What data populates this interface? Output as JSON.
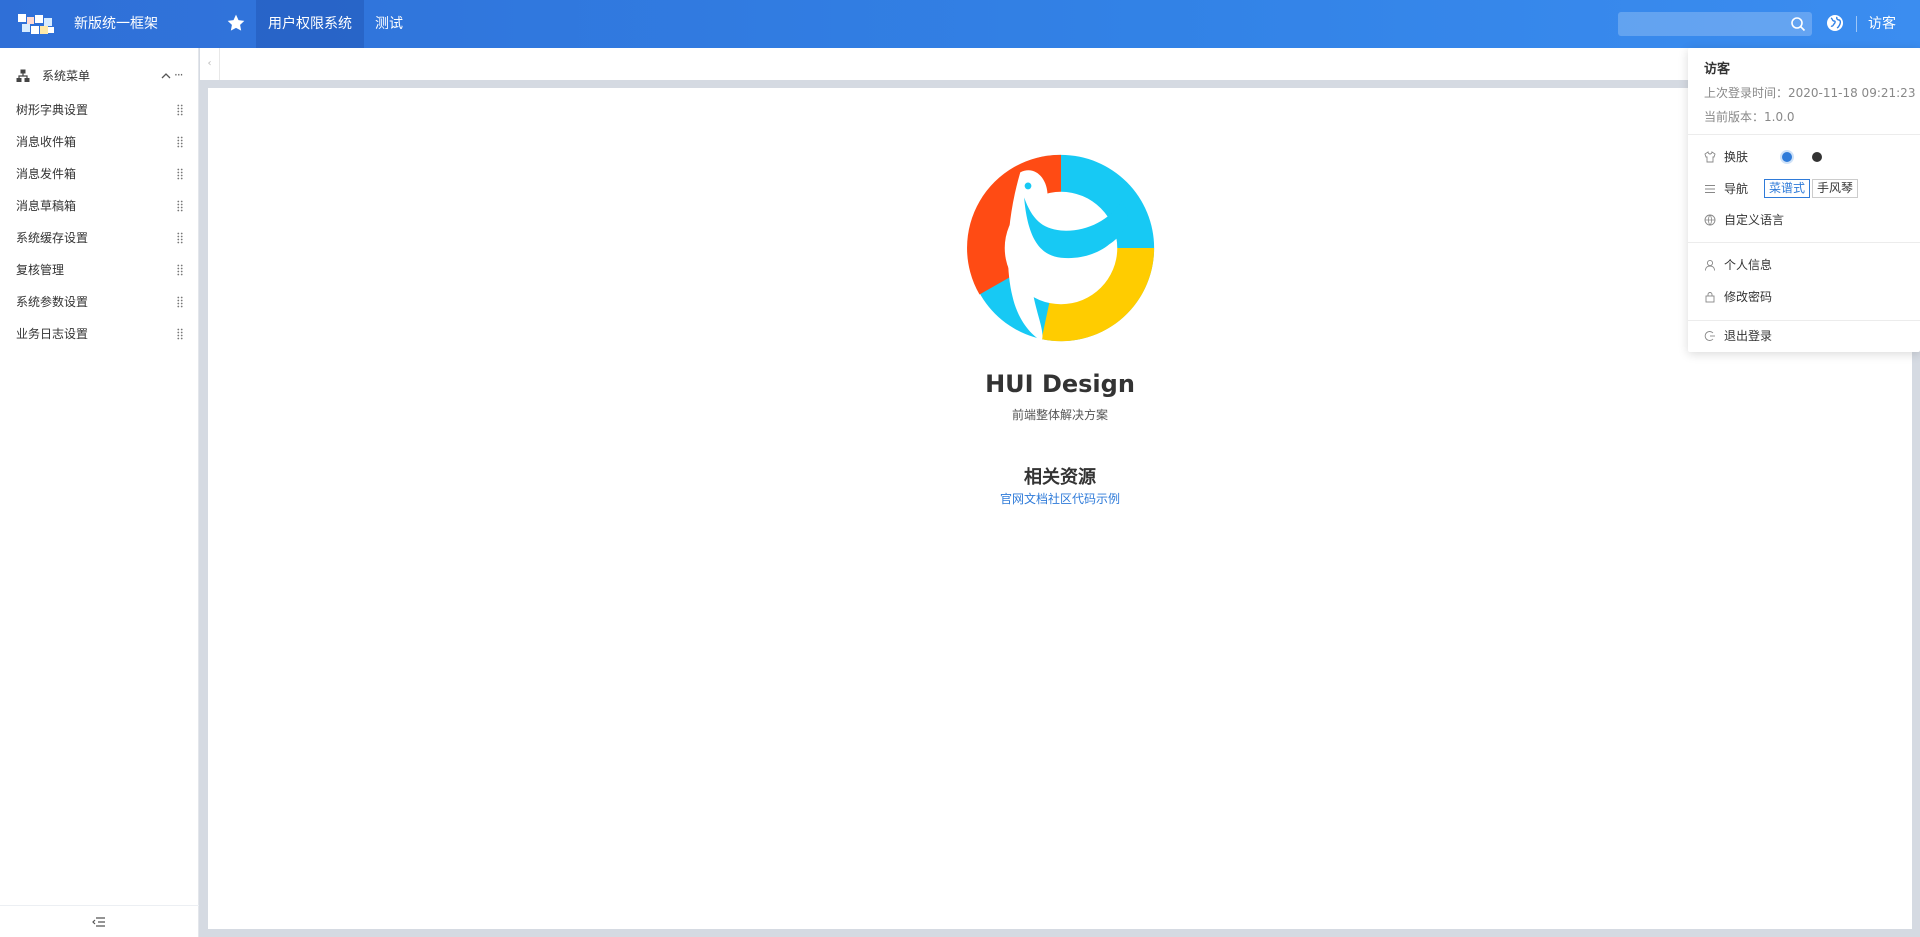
{
  "header": {
    "app_title": "新版统一框架",
    "nav_tabs": [
      {
        "label": "用户权限系统"
      },
      {
        "label": "测试"
      }
    ],
    "search": {
      "placeholder": ""
    },
    "user_name": "访客"
  },
  "sidebar": {
    "menu_title": "系统菜单",
    "more_label": "···",
    "items": [
      {
        "label": "树形字典设置"
      },
      {
        "label": "消息收件箱"
      },
      {
        "label": "消息发件箱"
      },
      {
        "label": "消息草稿箱"
      },
      {
        "label": "系统缓存设置"
      },
      {
        "label": "复核管理"
      },
      {
        "label": "系统参数设置"
      },
      {
        "label": "业务日志设置"
      }
    ]
  },
  "main": {
    "title": "HUI Design",
    "subtitle": "前端整体解决方案",
    "resources_title": "相关资源",
    "resource_links": [
      {
        "label": "官网"
      },
      {
        "label": "文档"
      },
      {
        "label": "社区"
      },
      {
        "label": "代码示例"
      }
    ],
    "logo_colors": {
      "red": "#ff4b14",
      "cyan": "#17c9f4",
      "yellow": "#ffcc00"
    }
  },
  "user_dropdown": {
    "name": "访客",
    "last_login": "上次登录时间：2020-11-18 09:21:23",
    "version": "当前版本：1.0.0",
    "skin_label": "换肤",
    "nav_label": "导航",
    "nav_options": [
      {
        "label": "菜谱式",
        "selected": true
      },
      {
        "label": "手风琴",
        "selected": false
      }
    ],
    "language_label": "自定义语言",
    "profile_label": "个人信息",
    "password_label": "修改密码",
    "logout_label": "退出登录"
  },
  "colors": {
    "accent": "#2f7bd9",
    "header": "#3282e6"
  }
}
